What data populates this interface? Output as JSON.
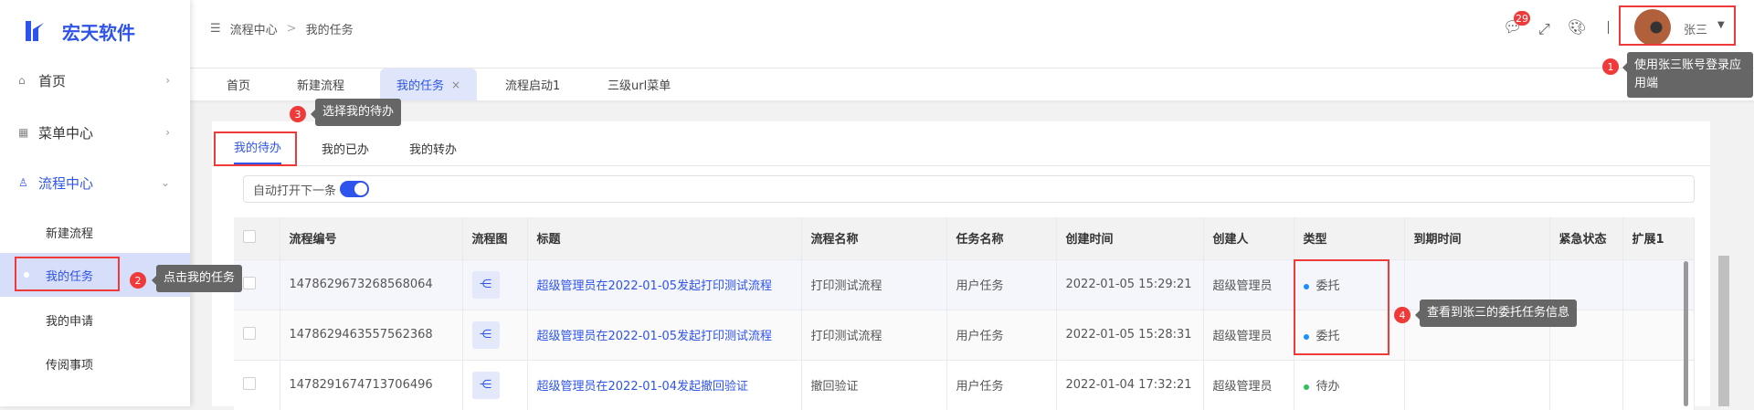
{
  "brand": {
    "name": "宏天软件",
    "color": "#2f54eb"
  },
  "sidebar": {
    "items": [
      {
        "label": "首页",
        "icon": "home-icon"
      },
      {
        "label": "菜单中心",
        "icon": "grid-icon"
      },
      {
        "label": "流程中心",
        "icon": "stamp-icon"
      }
    ],
    "sub_items": [
      {
        "label": "新建流程"
      },
      {
        "label": "我的任务"
      },
      {
        "label": "我的申请"
      },
      {
        "label": "传阅事项"
      }
    ]
  },
  "header": {
    "breadcrumb": [
      "流程中心",
      "我的任务"
    ],
    "message_count": "29",
    "user": "张三"
  },
  "tabs": [
    {
      "label": "首页"
    },
    {
      "label": "新建流程"
    },
    {
      "label": "我的任务",
      "close": "×"
    },
    {
      "label": "流程启动1"
    },
    {
      "label": "三级url菜单"
    }
  ],
  "subtabs": [
    {
      "label": "我的待办"
    },
    {
      "label": "我的已办"
    },
    {
      "label": "我的转办"
    }
  ],
  "toolbar": {
    "auto_next_label": "自动打开下一条",
    "auto_next_on": true
  },
  "table": {
    "columns": [
      "流程编号",
      "流程图",
      "标题",
      "流程名称",
      "任务名称",
      "创建时间",
      "创建人",
      "类型",
      "到期时间",
      "紧急状态",
      "扩展1"
    ],
    "rows": [
      {
        "id": "1478629673268568064",
        "title": "超级管理员在2022-01-05发起打印测试流程",
        "flow": "打印测试流程",
        "task": "用户任务",
        "created": "2022-01-05 15:29:21",
        "creator": "超级管理员",
        "type": "委托",
        "type_color": "#1890ff"
      },
      {
        "id": "1478629463557562368",
        "title": "超级管理员在2022-01-05发起打印测试流程",
        "flow": "打印测试流程",
        "task": "用户任务",
        "created": "2022-01-05 15:28:31",
        "creator": "超级管理员",
        "type": "委托",
        "type_color": "#1890ff"
      },
      {
        "id": "1478291674713706496",
        "title": "超级管理员在2022-01-04发起撤回验证",
        "flow": "撤回验证",
        "task": "用户任务",
        "created": "2022-01-04 17:32:21",
        "creator": "超级管理员",
        "type": "待办",
        "type_color": "#2fc25b"
      }
    ]
  },
  "annotations": [
    {
      "num": "1",
      "text": "使用张三账号登录应用端"
    },
    {
      "num": "2",
      "text": "点击我的任务"
    },
    {
      "num": "3",
      "text": "选择我的待办"
    },
    {
      "num": "4",
      "text": "查看到张三的委托任务信息"
    }
  ]
}
